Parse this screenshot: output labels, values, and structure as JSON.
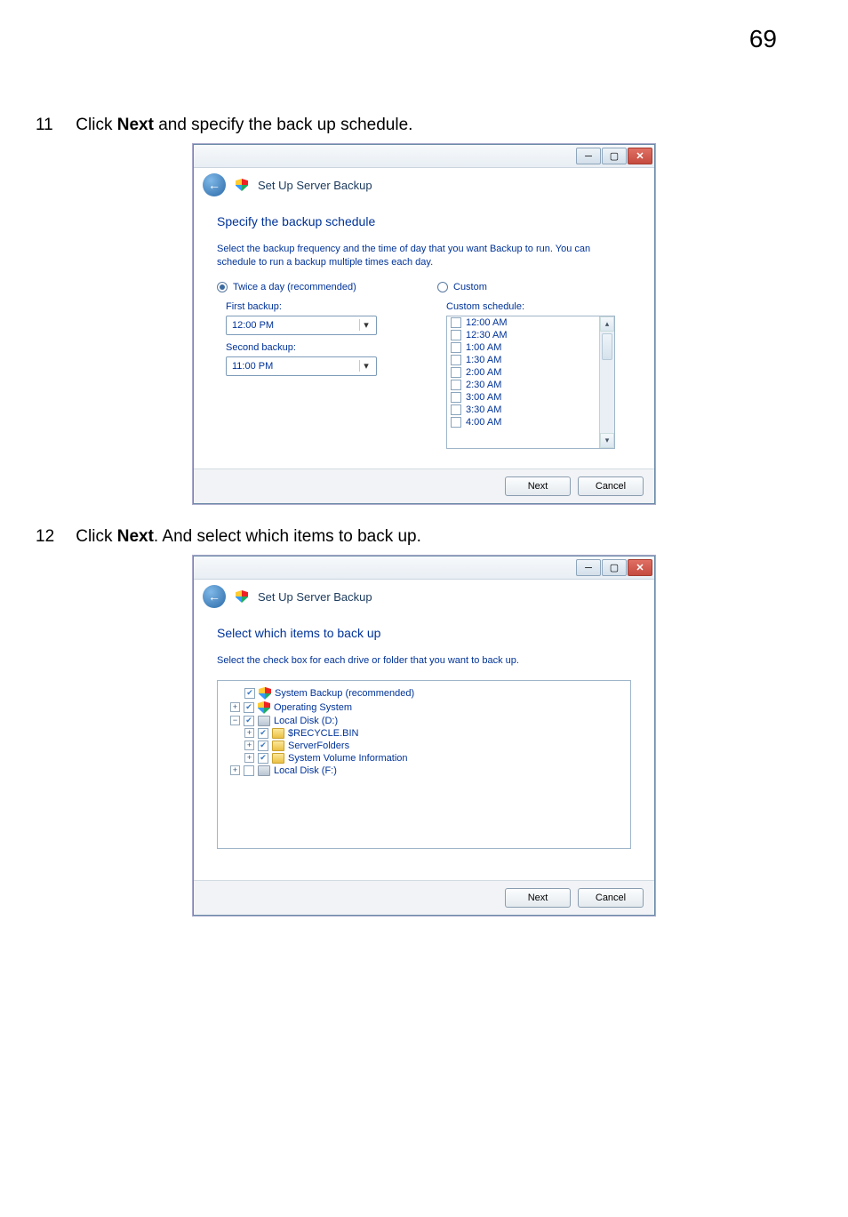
{
  "page_number": "69",
  "step11": {
    "num": "11",
    "pre": "Click ",
    "bold": "Next",
    "post": " and specify the back up schedule."
  },
  "step12": {
    "num": "12",
    "pre": "Click ",
    "bold": "Next",
    "post": ". And select which items to back up."
  },
  "wizard_title": "Set Up Server Backup",
  "window1": {
    "section_title": "Specify the backup schedule",
    "section_desc": "Select the backup frequency and the time of day that you want Backup to run. You can schedule to run a backup multiple times each day.",
    "left_radio": "Twice a day (recommended)",
    "right_radio": "Custom",
    "first_label": "First backup:",
    "first_value": "12:00 PM",
    "second_label": "Second backup:",
    "second_value": "11:00 PM",
    "custom_label": "Custom schedule:",
    "times": [
      "12:00 AM",
      "12:30 AM",
      "1:00 AM",
      "1:30 AM",
      "2:00 AM",
      "2:30 AM",
      "3:00 AM",
      "3:30 AM",
      "4:00 AM"
    ]
  },
  "window2": {
    "section_title": "Select which items to back up",
    "section_desc": "Select the check box for each drive or folder that you want to back up.",
    "tree": {
      "n0": "System Backup (recommended)",
      "n1": "Operating System",
      "n2": "Local Disk (D:)",
      "n3": "$RECYCLE.BIN",
      "n4": "ServerFolders",
      "n5": "System Volume Information",
      "n6": "Local Disk (F:)"
    }
  },
  "buttons": {
    "next": "Next",
    "cancel": "Cancel"
  },
  "winctrl": {
    "min": "─",
    "max": "▢",
    "close": "✕"
  }
}
